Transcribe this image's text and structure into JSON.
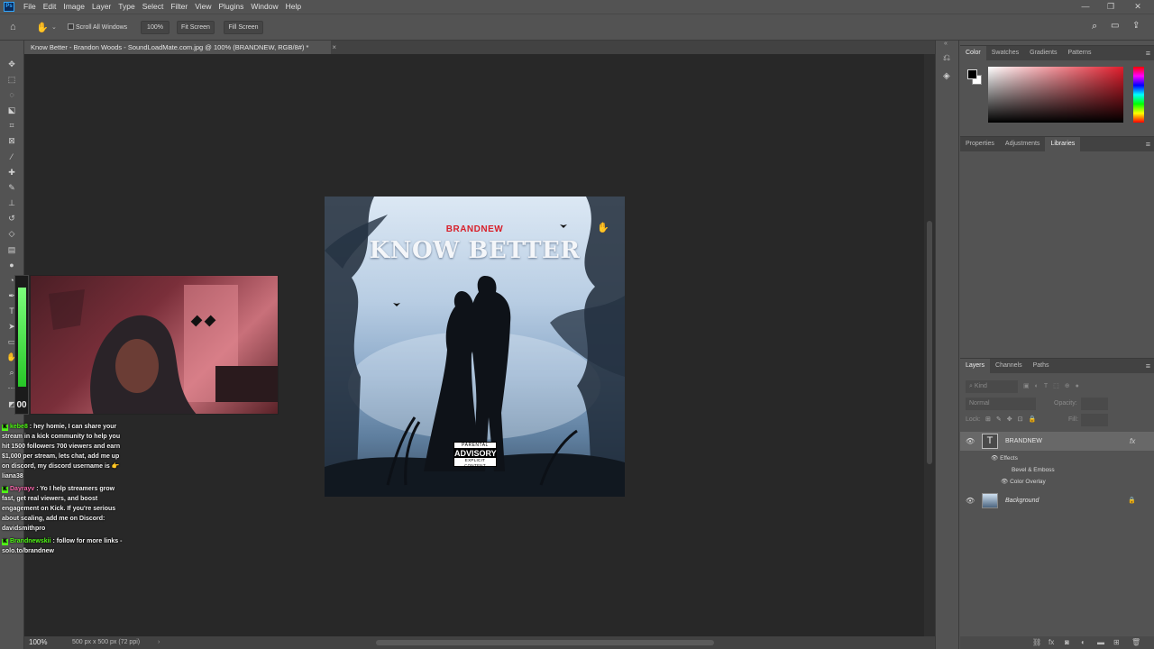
{
  "app": {
    "logo": "Ps",
    "menu": [
      "File",
      "Edit",
      "Image",
      "Layer",
      "Type",
      "Select",
      "Filter",
      "View",
      "Plugins",
      "Window",
      "Help"
    ],
    "window_controls": [
      "—",
      "❐",
      "✕"
    ]
  },
  "options_bar": {
    "scroll_all_windows": "Scroll All Windows",
    "zoom_value": "100%",
    "fit_screen": "Fit Screen",
    "fill_screen": "Fill Screen"
  },
  "document": {
    "tab_title": "Know Better - Brandon Woods - SoundLoadMate.com.jpg @ 100% (BRANDNEW, RGB/8#) *",
    "close": "×"
  },
  "artwork": {
    "brand": "BRANDNEW",
    "title": "KNOW BETTER",
    "advisory_top": "PARENTAL",
    "advisory_mid": "ADVISORY",
    "advisory_bottom": "EXPLICIT CONTENT"
  },
  "stream_overlay": {
    "meter_value": "00",
    "chat": [
      {
        "user": "kebe8",
        "text": " : hey homie, I can share your stream in a kick community to help you hit 1500 followers 700 viewers and earn $1,000 per stream, lets chat, add me up on discord, my discord username is 👉 liana38"
      },
      {
        "user": "Dayrayv",
        "text": " : Yo I help streamers grow fast, get real viewers, and boost engagement on Kick. If you're serious about scaling, add me on Discord: davidsmithpro"
      },
      {
        "user": "Brandnewskii",
        "text": " : follow for more links - solo.to/brandnew"
      }
    ]
  },
  "status_bar": {
    "zoom": "100%",
    "doc_info": "500 px x 500 px (72 ppi)"
  },
  "panels": {
    "color_tabs": [
      "Color",
      "Swatches",
      "Gradients",
      "Patterns"
    ],
    "property_tabs": [
      "Properties",
      "Adjustments",
      "Libraries"
    ],
    "layers_tabs": [
      "Layers",
      "Channels",
      "Paths"
    ],
    "kind_placeholder": "Kind",
    "blend_mode": "Normal",
    "opacity_label": "Opacity:",
    "lock_label": "Lock:",
    "fill_label": "Fill:",
    "layers": [
      {
        "name": "BRANDNEW",
        "type": "text",
        "fx": "fx"
      },
      {
        "name": "Background",
        "type": "image"
      }
    ],
    "effects_label": "Effects",
    "effects": [
      "Bevel & Emboss",
      "Color Overlay"
    ]
  },
  "colors": {
    "accent_blue": "#31a8ff",
    "kick_green": "#53fc18",
    "brand_red": "#d8202a"
  }
}
